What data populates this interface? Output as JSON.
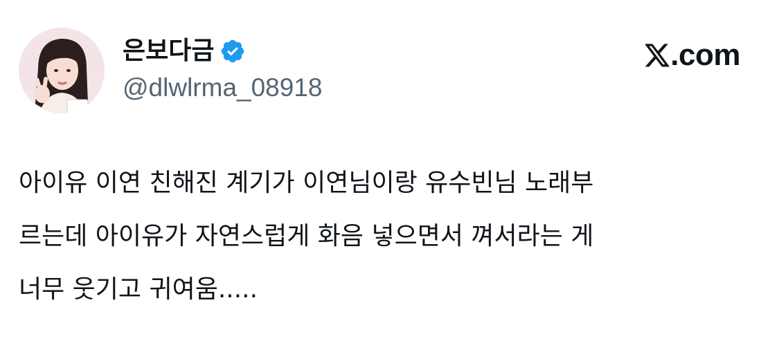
{
  "post": {
    "author": {
      "display_name": "은보다금",
      "handle": "@dlwlrma_08918",
      "verified": true,
      "verified_icon": "verified-badge-icon",
      "verified_color": "#1d9bf0"
    },
    "brand": {
      "logo_icon": "x-logo-icon",
      "text": ".com"
    },
    "text_lines": [
      "아이유 이연 친해진 계기가 이연님이랑 유수빈님 노래부",
      "르는데 아이유가 자연스럽게 화음 넣으면서 껴서라는 게",
      "너무 웃기고 귀여움....."
    ]
  }
}
